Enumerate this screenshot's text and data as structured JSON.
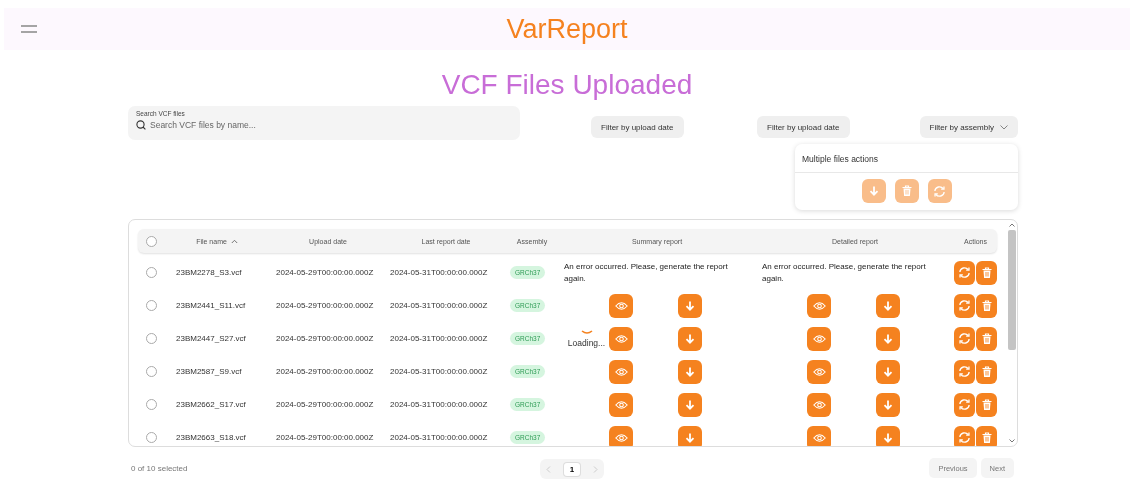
{
  "app_bar": {
    "title": "VarReport"
  },
  "page_title": "VCF Files Uploaded",
  "search": {
    "label": "Search VCF files",
    "placeholder": "Search VCF files by name..."
  },
  "filters": [
    {
      "label": "Filter by upload date",
      "kind": "plain"
    },
    {
      "label": "Filter by upload date",
      "kind": "plain"
    },
    {
      "label": "Filter by assembly",
      "kind": "dropdown"
    }
  ],
  "bulk_actions": {
    "title": "Multiple files actions",
    "disabled": true,
    "buttons": [
      {
        "kind": "download"
      },
      {
        "kind": "delete"
      },
      {
        "kind": "regenerate"
      }
    ]
  },
  "table": {
    "select_all": {
      "checked": false
    },
    "columns": [
      {
        "label": "File name",
        "sorted": true
      },
      {
        "label": "Upload date",
        "sorted": false
      },
      {
        "label": "Last report date",
        "sorted": false
      },
      {
        "label": "Assembly",
        "sorted": false
      },
      {
        "label": "Summary report",
        "sorted": false
      },
      {
        "label": "Detailed report",
        "sorted": false
      },
      {
        "label": "Actions",
        "sorted": false
      }
    ],
    "rows": [
      {
        "checked": false,
        "file": "23BM2278_S3.vcf",
        "upload": "2024-05-29T00:00:00.000Z",
        "last": "2024-05-31T00:00:00.000Z",
        "assembly": "GRCh37",
        "summary": {
          "kind": "error",
          "message": "An error occurred. Please, generate the report again."
        },
        "detailed": {
          "kind": "error",
          "message": "An error occurred. Please, generate the report again."
        }
      },
      {
        "checked": false,
        "file": "23BM2441_S11.vcf",
        "upload": "2024-05-29T00:00:00.000Z",
        "last": "2024-05-31T00:00:00.000Z",
        "assembly": "GRCh37",
        "summary": {
          "kind": "ready"
        },
        "detailed": {
          "kind": "ready"
        }
      },
      {
        "checked": false,
        "file": "23BM2447_S27.vcf",
        "upload": "2024-05-29T00:00:00.000Z",
        "last": "2024-05-31T00:00:00.000Z",
        "assembly": "GRCh37",
        "summary": {
          "kind": "loading",
          "message": "Loading..."
        },
        "detailed": {
          "kind": "ready"
        }
      },
      {
        "checked": false,
        "file": "23BM2587_S9.vcf",
        "upload": "2024-05-29T00:00:00.000Z",
        "last": "2024-05-31T00:00:00.000Z",
        "assembly": "GRCh37",
        "summary": {
          "kind": "ready"
        },
        "detailed": {
          "kind": "ready"
        }
      },
      {
        "checked": false,
        "file": "23BM2662_S17.vcf",
        "upload": "2024-05-29T00:00:00.000Z",
        "last": "2024-05-31T00:00:00.000Z",
        "assembly": "GRCh37",
        "summary": {
          "kind": "ready"
        },
        "detailed": {
          "kind": "ready"
        }
      },
      {
        "checked": false,
        "file": "23BM2663_S18.vcf",
        "upload": "2024-05-29T00:00:00.000Z",
        "last": "2024-05-31T00:00:00.000Z",
        "assembly": "GRCh37",
        "summary": {
          "kind": "ready"
        },
        "detailed": {
          "kind": "ready"
        }
      }
    ]
  },
  "footer": {
    "selection": "0 of 10 selected",
    "pages": [
      {
        "label": "1",
        "selected": true
      }
    ],
    "previous": "Previous",
    "next": "Next"
  }
}
